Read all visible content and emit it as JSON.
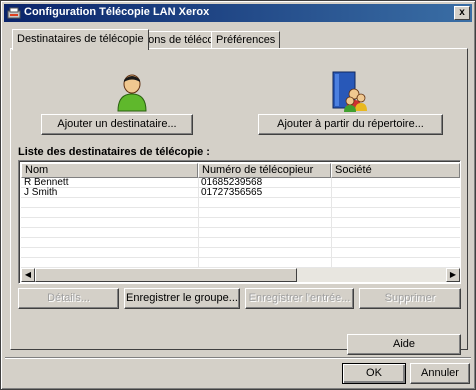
{
  "window": {
    "title": "Configuration Télécopie LAN Xerox",
    "close_label": "x",
    "icon": "xerox-app-icon"
  },
  "tabs": [
    {
      "label": "Destinataires de télécopie",
      "active": true
    },
    {
      "label": "Options de télécopie",
      "active": false
    },
    {
      "label": "Préférences",
      "active": false
    }
  ],
  "recipients": {
    "add_recipient_label": "Ajouter un destinataire...",
    "add_from_directory_label": "Ajouter à partir du répertoire...",
    "list_title": "Liste des destinataires de télécopie :",
    "columns": [
      "Nom",
      "Numéro de télécopieur",
      "Société"
    ],
    "rows": [
      {
        "name": "R Bennett",
        "fax": "01685239568",
        "company": ""
      },
      {
        "name": "J Smith",
        "fax": "01727356565",
        "company": ""
      }
    ],
    "details_label": "Détails...",
    "save_group_label": "Enregistrer le groupe...",
    "save_entry_label": "Enregistrer l'entrée...",
    "delete_label": "Supprimer"
  },
  "footer": {
    "help_label": "Aide",
    "ok_label": "OK",
    "cancel_label": "Annuler"
  },
  "icons": {
    "person": "person-icon",
    "directory": "address-book-icon"
  },
  "colors": {
    "title_gradient_start": "#0a246a",
    "title_gradient_end": "#3a6ea5",
    "face": "#d4d0c8"
  }
}
